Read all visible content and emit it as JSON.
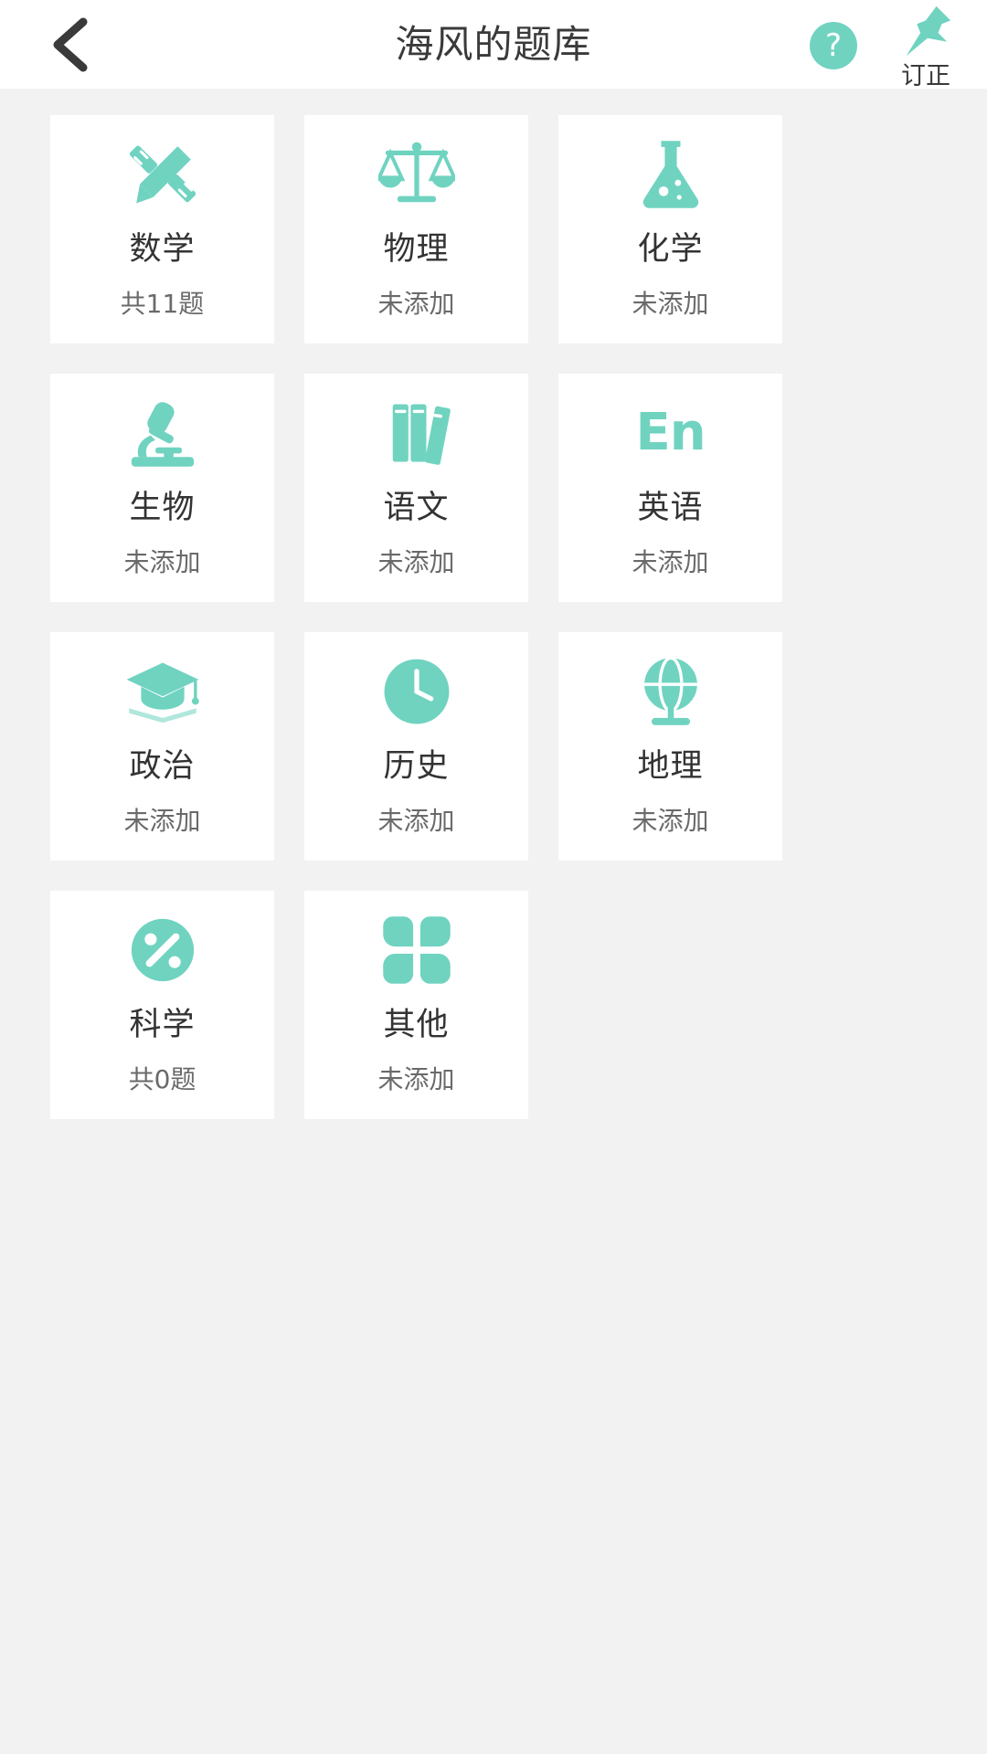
{
  "theme": {
    "accent": "#6fd3c0",
    "background": "#f2f2f2",
    "card_background": "#ffffff",
    "title_color": "#333333",
    "subtitle_color": "#6a6a6a"
  },
  "header": {
    "title": "海风的题库",
    "back_icon": "chevron-left-icon",
    "help_icon": "question-mark-icon",
    "help_label": "?",
    "pin_icon": "pushpin-icon",
    "pin_label": "订正"
  },
  "grid": {
    "cards": [
      {
        "title": "数学",
        "count": "共11题",
        "icon": "pencil-ruler-icon"
      },
      {
        "title": "物理",
        "count": "未添加",
        "icon": "balance-scale-icon"
      },
      {
        "title": "化学",
        "count": "未添加",
        "icon": "flask-icon"
      },
      {
        "title": "生物",
        "count": "未添加",
        "icon": "microscope-icon"
      },
      {
        "title": "语文",
        "count": "未添加",
        "icon": "books-icon"
      },
      {
        "title": "英语",
        "count": "未添加",
        "icon": "en-text-icon"
      },
      {
        "title": "政治",
        "count": "未添加",
        "icon": "graduation-cap-icon"
      },
      {
        "title": "历史",
        "count": "未添加",
        "icon": "clock-icon"
      },
      {
        "title": "地理",
        "count": "未添加",
        "icon": "globe-icon"
      },
      {
        "title": "科学",
        "count": "共0题",
        "icon": "atom-icon"
      },
      {
        "title": "其他",
        "count": "未添加",
        "icon": "four-petals-icon"
      }
    ]
  }
}
